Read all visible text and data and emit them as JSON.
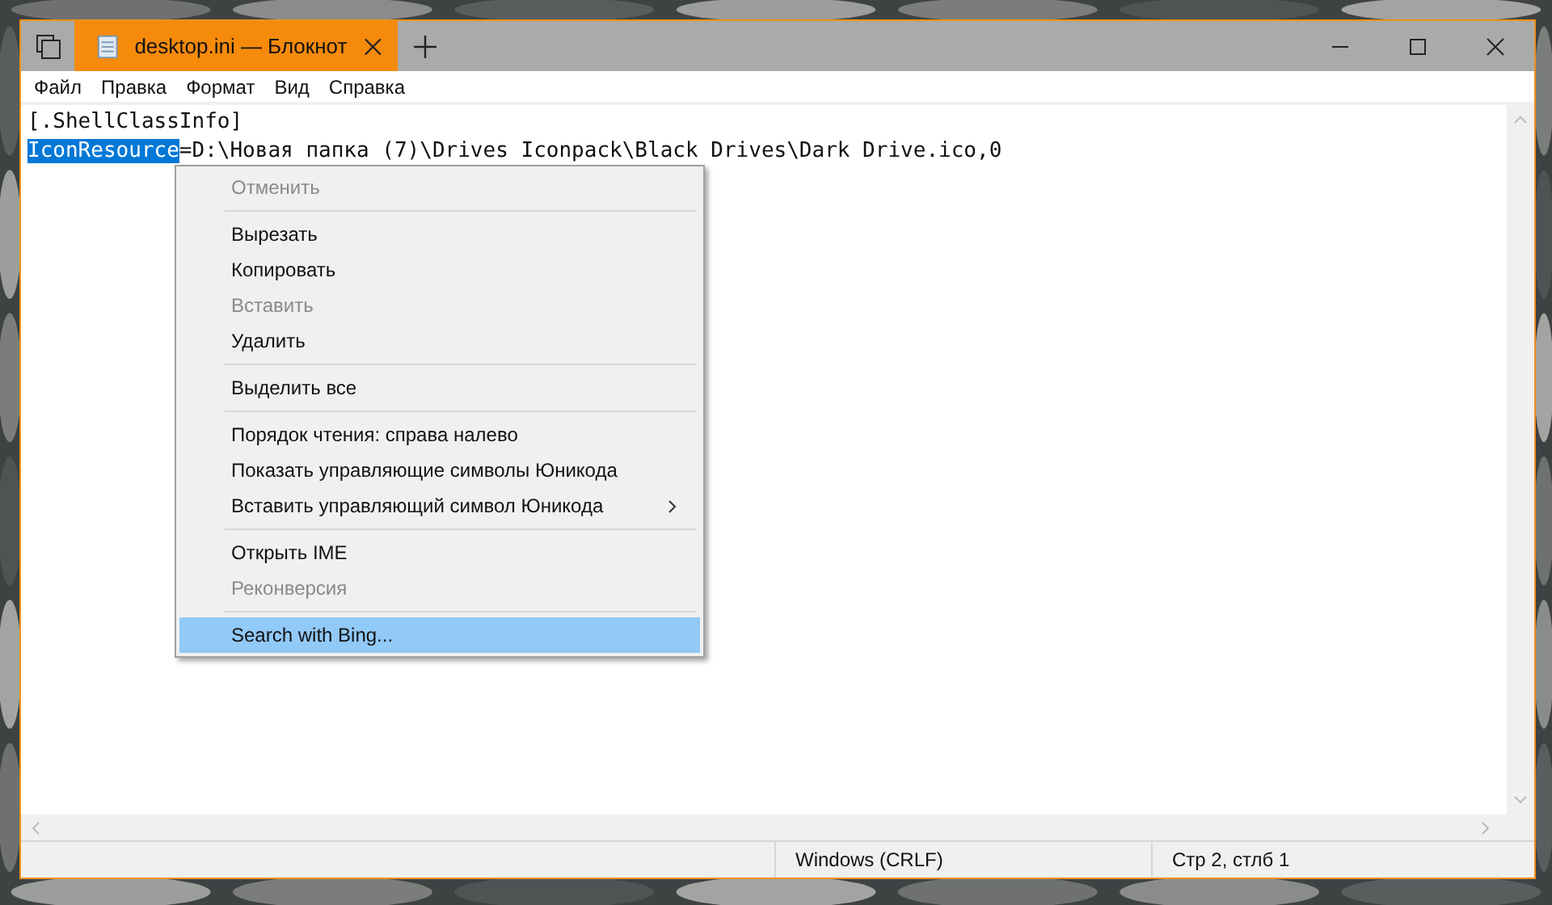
{
  "window": {
    "title": "desktop.ini — Блокнот",
    "tab_selected": true
  },
  "menu_bar": [
    "Файл",
    "Правка",
    "Формат",
    "Вид",
    "Справка"
  ],
  "editor": {
    "lines": [
      {
        "text": "[.ShellClassInfo]"
      },
      {
        "selected_text": "IconResource",
        "text": "=D:\\Новая папка (7)\\Drives Iconpack\\Black Drives\\Dark Drive.ico,0"
      }
    ]
  },
  "context_menu": [
    {
      "kind": "item",
      "label": "Отменить",
      "disabled": true,
      "selected": false
    },
    {
      "kind": "separator"
    },
    {
      "kind": "item",
      "label": "Вырезать",
      "disabled": false,
      "selected": false
    },
    {
      "kind": "item",
      "label": "Копировать",
      "disabled": false,
      "selected": false
    },
    {
      "kind": "item",
      "label": "Вставить",
      "disabled": true,
      "selected": false
    },
    {
      "kind": "item",
      "label": "Удалить",
      "disabled": false,
      "selected": false
    },
    {
      "kind": "separator"
    },
    {
      "kind": "item",
      "label": "Выделить все",
      "disabled": false,
      "selected": false
    },
    {
      "kind": "separator"
    },
    {
      "kind": "item",
      "label": "Порядок чтения: справа налево",
      "disabled": false,
      "selected": false
    },
    {
      "kind": "item",
      "label": "Показать управляющие символы Юникода",
      "disabled": false,
      "selected": false
    },
    {
      "kind": "submenu",
      "label": "Вставить управляющий символ Юникода",
      "disabled": false,
      "selected": false
    },
    {
      "kind": "separator"
    },
    {
      "kind": "item",
      "label": "Открыть IME",
      "disabled": false,
      "selected": false
    },
    {
      "kind": "item",
      "label": "Реконверсия",
      "disabled": true,
      "selected": false
    },
    {
      "kind": "separator"
    },
    {
      "kind": "item",
      "label": "Search with Bing...",
      "disabled": false,
      "selected": true
    }
  ],
  "status_bar": [
    "Windows (CRLF)",
    "Стр 2, стлб 1"
  ]
}
